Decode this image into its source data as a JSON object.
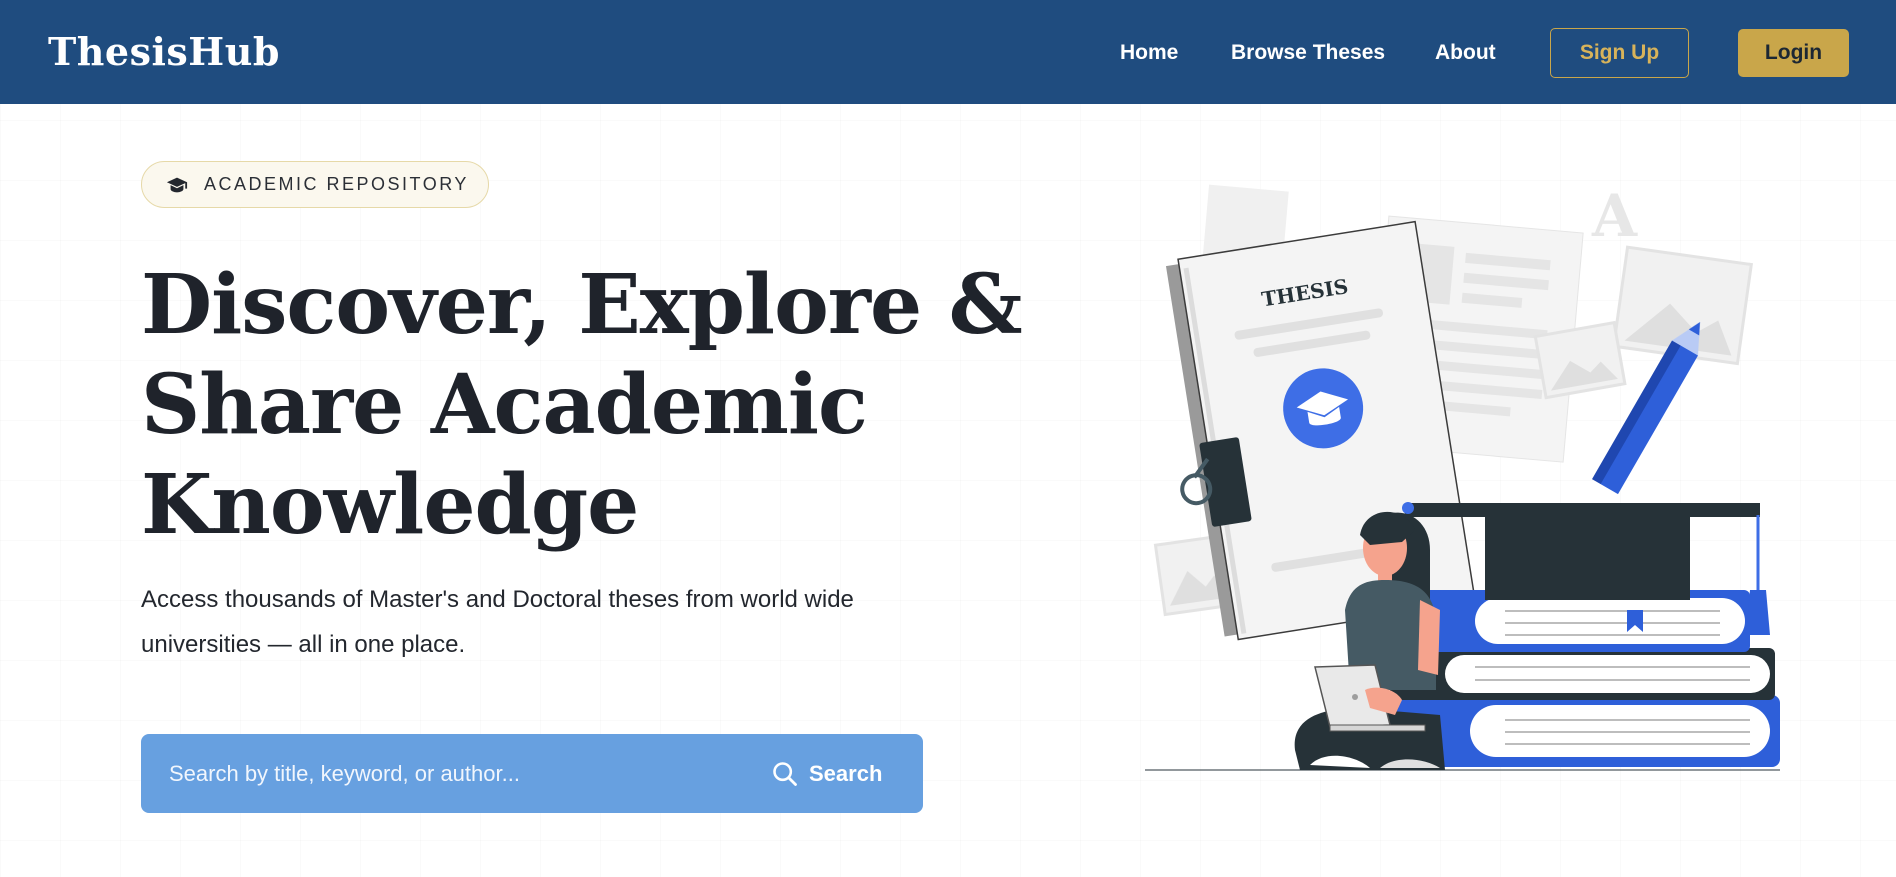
{
  "navbar": {
    "brand": "ThesisHub",
    "links": [
      {
        "label": "Home"
      },
      {
        "label": "Browse Theses"
      },
      {
        "label": "About"
      }
    ],
    "signup_label": "Sign Up",
    "login_label": "Login"
  },
  "hero": {
    "badge_icon": "graduation-cap-icon",
    "badge": "ACADEMIC REPOSITORY",
    "title_lines": [
      "Discover, Explore &",
      "Share Academic",
      "Knowledge"
    ],
    "subtitle": "Access thousands of Master's and Doctoral theses from world wide universities — all in one place.",
    "search": {
      "placeholder": "Search by title, keyword, or author...",
      "button_icon": "search-icon",
      "button_label": "Search"
    },
    "illustration": {
      "book_label": "THESIS",
      "letter": "A"
    }
  },
  "colors": {
    "navbar_bg": "#1f4c7f",
    "accent_gold": "#c9a64a",
    "search_bg": "#67a0e0",
    "illustration_blue": "#3e6ee6",
    "heading_text": "#1f232b"
  }
}
